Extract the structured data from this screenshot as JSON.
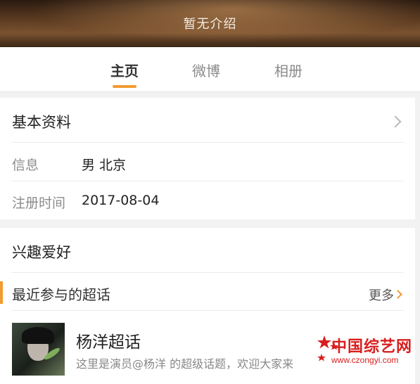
{
  "banner": {
    "intro": "暂无介绍"
  },
  "tabs": [
    {
      "label": "主页",
      "active": true
    },
    {
      "label": "微博",
      "active": false
    },
    {
      "label": "相册",
      "active": false
    }
  ],
  "basic_info": {
    "title": "基本资料",
    "rows": [
      {
        "label": "信息",
        "value": "男  北京"
      },
      {
        "label": "注册时间",
        "value": "2017-08-04"
      }
    ]
  },
  "interests": {
    "title": "兴趣爱好",
    "super_topics": {
      "title": "最近参与的超话",
      "more_label": "更多",
      "items": [
        {
          "name": "杨洋超话",
          "description": "这里是演员@杨洋 的超级话题，欢迎大家来"
        }
      ]
    }
  },
  "watermark": {
    "text": "中国综艺网",
    "url": "www.czongyi.com"
  },
  "colors": {
    "accent": "#f29b30",
    "watermark": "#d81e1e"
  },
  "icons": {
    "basic_info_arrow": "chevron-right-icon",
    "more_arrow": "chevron-right-icon"
  }
}
